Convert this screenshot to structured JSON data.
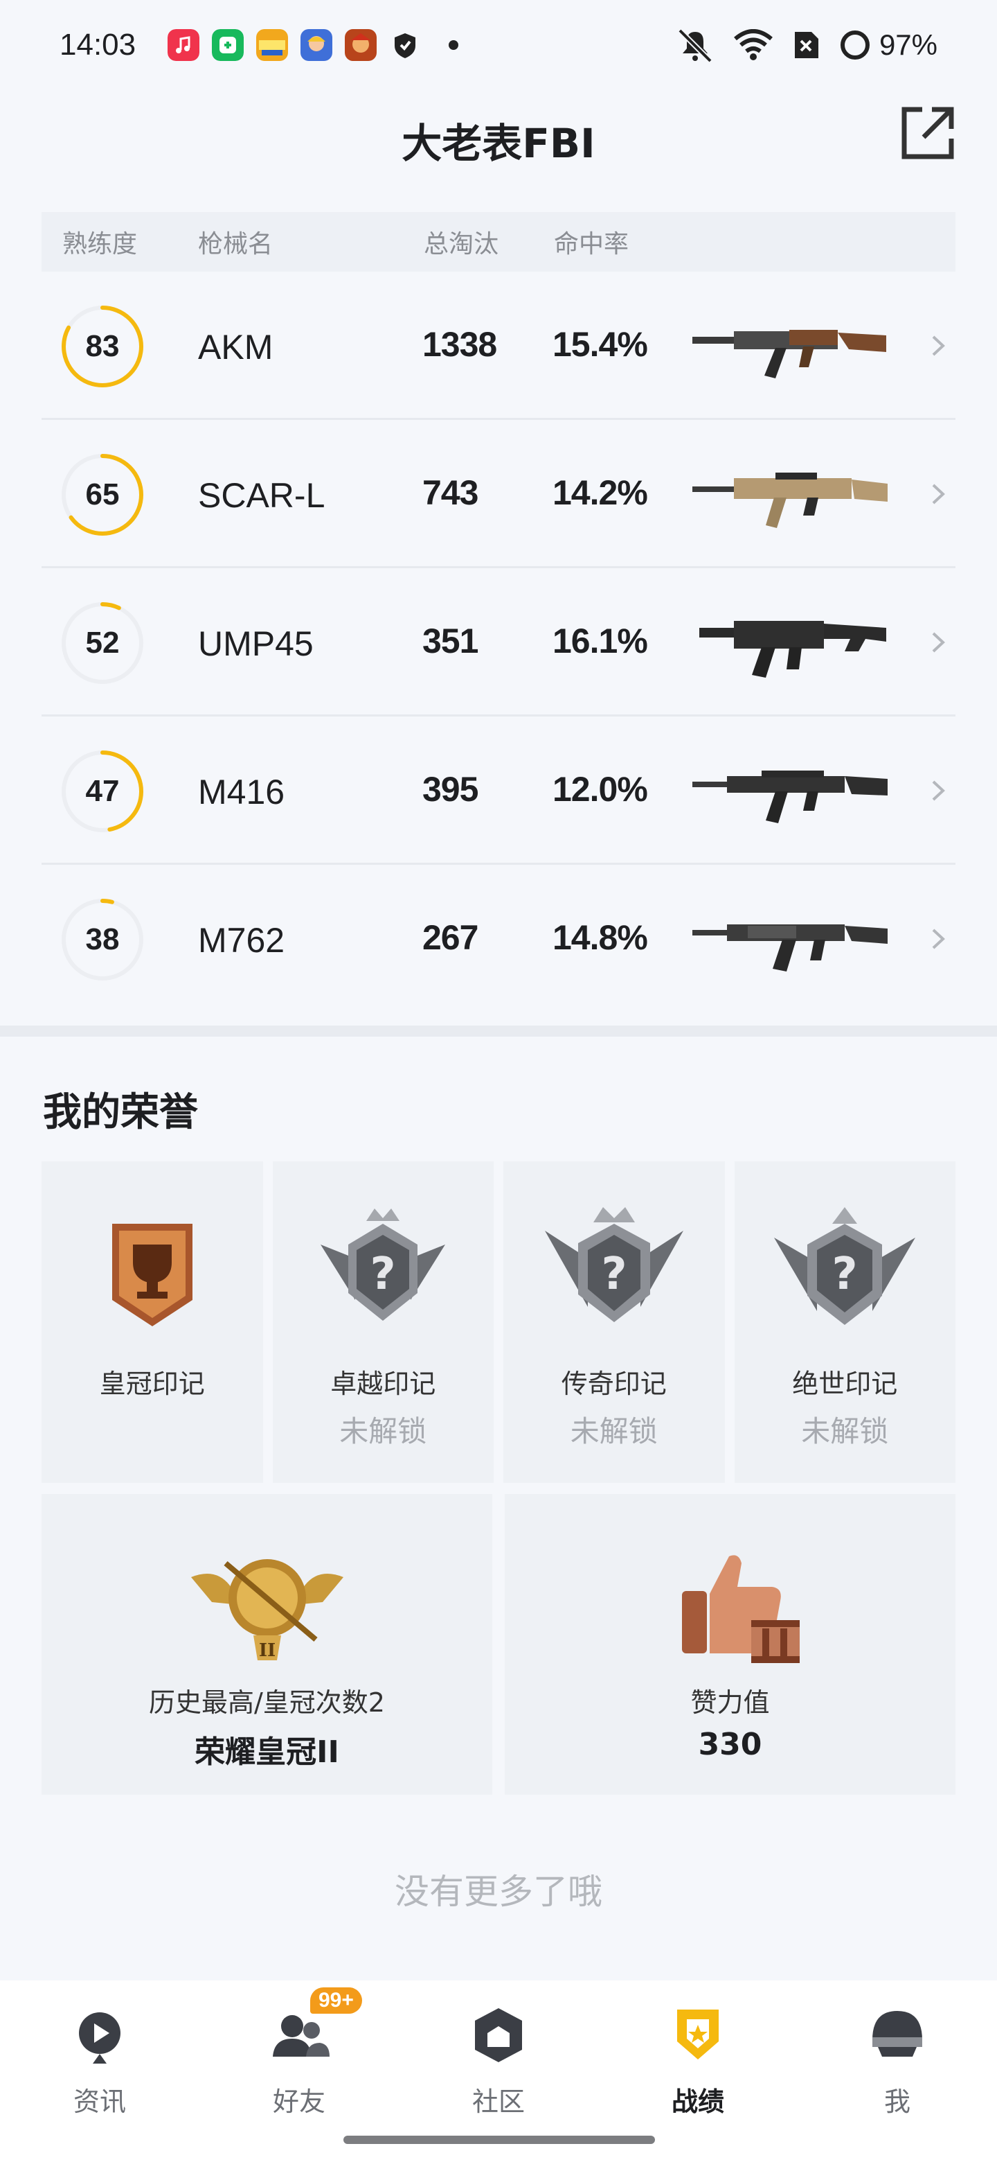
{
  "status_bar": {
    "time": "14:03",
    "battery": "97%",
    "icons": [
      "music-app-icon",
      "vpn-app-icon",
      "game-app-icon",
      "game2-app-icon",
      "game3-app-icon",
      "shield-app-icon",
      "dot-icon",
      "mute-icon",
      "wifi-icon",
      "sim-off-icon",
      "battery-icon"
    ]
  },
  "header": {
    "title": "大老表FBI",
    "share_icon": "share-icon"
  },
  "table": {
    "headers": [
      "熟练度",
      "枪械名",
      "总淘汰",
      "命中率"
    ],
    "rows": [
      {
        "proficiency": "83",
        "name": "AKM",
        "kills": "1338",
        "rate": "15.4%",
        "fill": 0.83
      },
      {
        "proficiency": "65",
        "name": "SCAR-L",
        "kills": "743",
        "rate": "14.2%",
        "fill": 0.65
      },
      {
        "proficiency": "52",
        "name": "UMP45",
        "kills": "351",
        "rate": "16.1%",
        "fill": 0.07
      },
      {
        "proficiency": "47",
        "name": "M416",
        "kills": "395",
        "rate": "12.0%",
        "fill": 0.47
      },
      {
        "proficiency": "38",
        "name": "M762",
        "kills": "267",
        "rate": "14.8%",
        "fill": 0.04
      }
    ]
  },
  "honors": {
    "title": "我的荣誉",
    "badges": [
      {
        "name": "皇冠印记",
        "status": ""
      },
      {
        "name": "卓越印记",
        "status": "未解锁"
      },
      {
        "name": "传奇印记",
        "status": "未解锁"
      },
      {
        "name": "绝世印记",
        "status": "未解锁"
      }
    ],
    "history": {
      "label": "历史最高/皇冠次数2",
      "value": "荣耀皇冠II"
    },
    "likes": {
      "label": "赞力值",
      "value": "330"
    }
  },
  "footer_text": "没有更多了哦",
  "nav": {
    "items": [
      {
        "label": "资讯",
        "icon": "play-icon"
      },
      {
        "label": "好友",
        "icon": "friends-icon",
        "badge": "99+"
      },
      {
        "label": "社区",
        "icon": "community-icon"
      },
      {
        "label": "战绩",
        "icon": "record-icon",
        "active": true
      },
      {
        "label": "我",
        "icon": "helmet-icon"
      }
    ]
  },
  "colors": {
    "accent": "#f5b90f",
    "ring_track": "#eceef2"
  }
}
